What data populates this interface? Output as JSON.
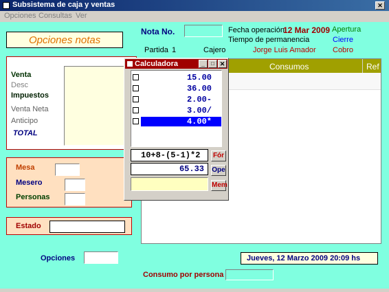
{
  "window": {
    "title": "Subsistema de caja y ventas",
    "close": "✕"
  },
  "menu": {
    "items": [
      "Opciones",
      "Consultas",
      "Ver"
    ]
  },
  "header": {
    "opciones_notas": "Opciones notas",
    "nota_label": "Nota No.",
    "fecha_label": "Fecha operación",
    "fecha_value": "12 Mar 2009",
    "apertura": "Apertura",
    "tiempo_label": "Tiempo de permanencia",
    "cierre": "Cierre",
    "partida_label": "Partida",
    "partida_value": "1",
    "cajero_label": "Cajero",
    "cajero_value": "Jorge Luis Amador",
    "cobro": "Cobro"
  },
  "totals": {
    "venta": "Venta",
    "desc": "Desc",
    "impuestos": "Impuestos",
    "venta_neta": "Venta Neta",
    "anticipo": "Anticipo",
    "total": "TOTAL"
  },
  "mesa_panel": {
    "mesa": "Mesa",
    "mesero": "Mesero",
    "personas": "Personas"
  },
  "estado_panel": {
    "estado": "Estado"
  },
  "grid": {
    "consumos_header": "Consumos",
    "ref_header": "Ref"
  },
  "footer": {
    "opciones": "Opciones",
    "consumo_por_persona": "Consumo por persona",
    "datetime": "Jueves,  12  Marzo  2009    20:09  hs"
  },
  "calculator": {
    "title": "Calculadora",
    "entries": [
      "15.00",
      "36.00",
      "2.00-",
      "3.00/",
      "4.00*"
    ],
    "selected_index": 4,
    "formula": "10+8-(5-1)*2",
    "result": "65.33",
    "buttons": {
      "formula": "Fór",
      "operation": "Ope",
      "memory": "Mem"
    }
  },
  "colors": {
    "background": "#80ffe0",
    "titlebar": "#0a246a",
    "accent_red": "#c00000",
    "navy": "#000080",
    "calc_title": "#a00000"
  }
}
